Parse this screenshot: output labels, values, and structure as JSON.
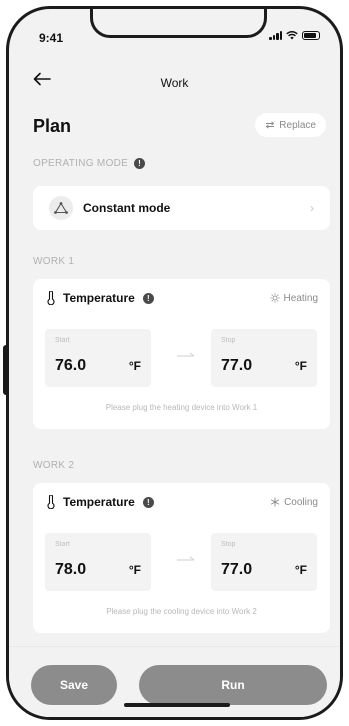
{
  "status": {
    "time": "9:41"
  },
  "nav": {
    "title": "Work"
  },
  "plan": {
    "title": "Plan",
    "replace_label": "Replace"
  },
  "operating_mode": {
    "section_label": "OPERATING MODE",
    "mode_label": "Constant mode"
  },
  "works": [
    {
      "section_label": "WORK 1",
      "title": "Temperature",
      "mode": "Heating",
      "mode_icon": "sun-icon",
      "start_label": "Start",
      "start_value": "76.0",
      "stop_label": "Stop",
      "stop_value": "77.0",
      "unit": "°F",
      "hint": "Please plug the heating device into Work 1"
    },
    {
      "section_label": "WORK 2",
      "title": "Temperature",
      "mode": "Cooling",
      "mode_icon": "snowflake-icon",
      "start_label": "Start",
      "start_value": "78.0",
      "stop_label": "Stop",
      "stop_value": "77.0",
      "unit": "°F",
      "hint": "Please plug the cooling device into Work 2"
    }
  ],
  "actions": {
    "save_label": "Save",
    "run_label": "Run"
  },
  "colors": {
    "button_gray": "#8c8c8c",
    "background": "#f2f2f2",
    "card": "#ffffff"
  }
}
